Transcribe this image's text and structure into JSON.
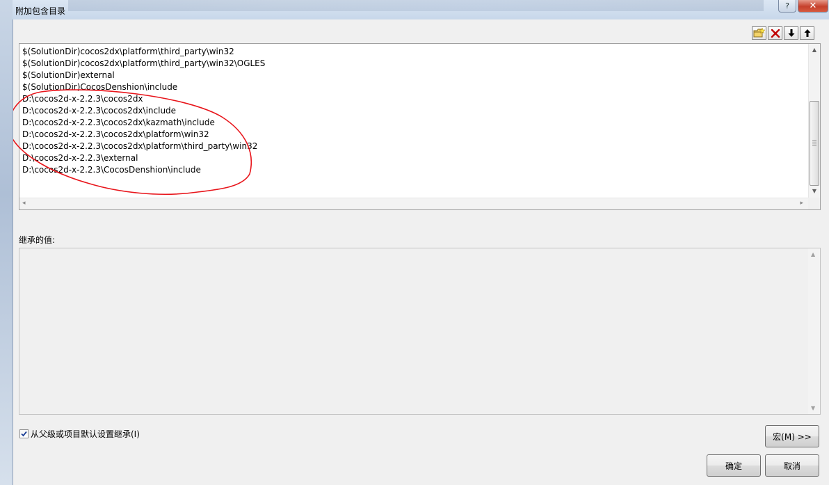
{
  "window": {
    "title": "附加包含目录",
    "help_label": "?",
    "close_label": "✕"
  },
  "toolbar": {
    "buttons": [
      {
        "name": "new-line-icon"
      },
      {
        "name": "delete-icon"
      },
      {
        "name": "move-down-icon"
      },
      {
        "name": "move-up-icon"
      }
    ]
  },
  "list": {
    "items": [
      "$(SolutionDir)cocos2dx\\platform\\third_party\\win32",
      "$(SolutionDir)cocos2dx\\platform\\third_party\\win32\\OGLES",
      "$(SolutionDir)external",
      "$(SolutionDir)CocosDenshion\\include",
      "D:\\cocos2d-x-2.2.3\\cocos2dx",
      "D:\\cocos2d-x-2.2.3\\cocos2dx\\include",
      "D:\\cocos2d-x-2.2.3\\cocos2dx\\kazmath\\include",
      "D:\\cocos2d-x-2.2.3\\cocos2dx\\platform\\win32",
      "D:\\cocos2d-x-2.2.3\\cocos2dx\\platform\\third_party\\win32",
      "D:\\cocos2d-x-2.2.3\\external",
      "D:\\cocos2d-x-2.2.3\\CocosDenshion\\include"
    ]
  },
  "inherited": {
    "label": "继承的值:"
  },
  "inherit_checkbox": {
    "label": "从父级或项目默认设置继承(I)",
    "checked": true
  },
  "buttons": {
    "macro": "宏(M) >>",
    "ok": "确定",
    "cancel": "取消"
  },
  "colors": {
    "annotation": "#e8151b",
    "delete_icon": "#c00000",
    "close_button": "#c6402c"
  }
}
